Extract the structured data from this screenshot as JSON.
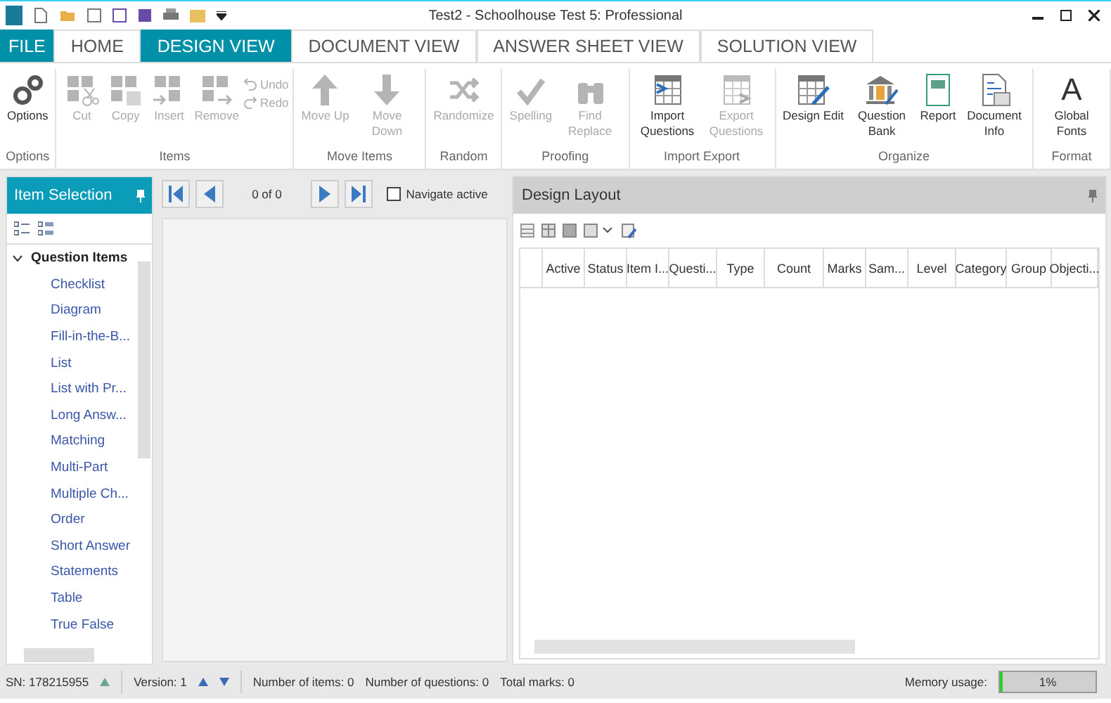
{
  "window": {
    "title": "Test2 - Schoolhouse Test 5: Professional"
  },
  "file_menu": {
    "label": "FILE"
  },
  "tabs": [
    {
      "label": "HOME",
      "selected": false
    },
    {
      "label": "DESIGN VIEW",
      "selected": true
    },
    {
      "label": "DOCUMENT VIEW",
      "selected": false
    },
    {
      "label": "ANSWER SHEET VIEW",
      "selected": false
    },
    {
      "label": "SOLUTION VIEW",
      "selected": false
    }
  ],
  "ribbon": [
    {
      "label": "Options",
      "buttons": [
        {
          "label": "Options",
          "kind": "large",
          "disabled": false
        }
      ]
    },
    {
      "label": "Items",
      "buttons": [
        {
          "label": "Cut",
          "kind": "large",
          "disabled": true
        },
        {
          "label": "Copy",
          "kind": "large",
          "disabled": true
        },
        {
          "label": "Insert",
          "kind": "large",
          "disabled": true
        },
        {
          "label": "Remove",
          "kind": "large",
          "disabled": true
        },
        {
          "label": "Undo",
          "kind": "small",
          "disabled": true
        },
        {
          "label": "Redo",
          "kind": "small",
          "disabled": true
        }
      ]
    },
    {
      "label": "Move Items",
      "buttons": [
        {
          "label": "Move Up",
          "kind": "large",
          "disabled": true
        },
        {
          "label": "Move Down",
          "kind": "large",
          "disabled": true
        }
      ]
    },
    {
      "label": "Random",
      "buttons": [
        {
          "label": "Randomize",
          "kind": "large",
          "disabled": true
        }
      ]
    },
    {
      "label": "Proofing",
      "buttons": [
        {
          "label": "Spelling",
          "kind": "large",
          "disabled": true
        },
        {
          "label": "Find Replace",
          "kind": "large",
          "disabled": true
        }
      ]
    },
    {
      "label": "Import Export",
      "buttons": [
        {
          "label": "Import Questions",
          "kind": "large",
          "disabled": false
        },
        {
          "label": "Export Questions",
          "kind": "large",
          "disabled": true
        }
      ]
    },
    {
      "label": "Organize",
      "buttons": [
        {
          "label": "Design Edit",
          "kind": "large",
          "disabled": false
        },
        {
          "label": "Question Bank",
          "kind": "large",
          "disabled": false
        },
        {
          "label": "Report",
          "kind": "large",
          "disabled": false
        },
        {
          "label": "Document Info",
          "kind": "large",
          "disabled": false
        }
      ]
    },
    {
      "label": "Format",
      "buttons": [
        {
          "label": "Global Fonts",
          "kind": "glyph",
          "glyph": "A",
          "disabled": false
        }
      ]
    }
  ],
  "item_selection": {
    "title": "Item Selection",
    "tree": [
      {
        "label": "Question Items",
        "expanded": true,
        "children": [
          {
            "label": "Checklist"
          },
          {
            "label": "Diagram"
          },
          {
            "label": "Fill-in-the-B..."
          },
          {
            "label": "List"
          },
          {
            "label": "List with Pr..."
          },
          {
            "label": "Long Answ..."
          },
          {
            "label": "Matching"
          },
          {
            "label": "Multi-Part"
          },
          {
            "label": "Multiple  Ch..."
          },
          {
            "label": "Order"
          },
          {
            "label": "Short Answer"
          },
          {
            "label": "Statements"
          },
          {
            "label": "Table"
          },
          {
            "label": "True False"
          }
        ]
      }
    ]
  },
  "navigator": {
    "position": "0 of 0",
    "navigate_active": {
      "label": "Navigate active",
      "checked": false
    }
  },
  "design_layout": {
    "title": "Design Layout",
    "columns": [
      "",
      "Active",
      "Status",
      "Item I...",
      "Questi...",
      "Type",
      "Count",
      "Marks",
      "Sam...",
      "Level",
      "Category",
      "Group",
      "Objecti..."
    ]
  },
  "status_bar": {
    "sn": "SN:  178215955",
    "version": "Version: 1",
    "items": "Number of items: 0",
    "questions": "Number of questions: 0",
    "marks": "Total marks: 0",
    "memory_label": "Memory usage:",
    "memory_level": {
      "level": 0.01
    },
    "memory_reading": "1%"
  }
}
